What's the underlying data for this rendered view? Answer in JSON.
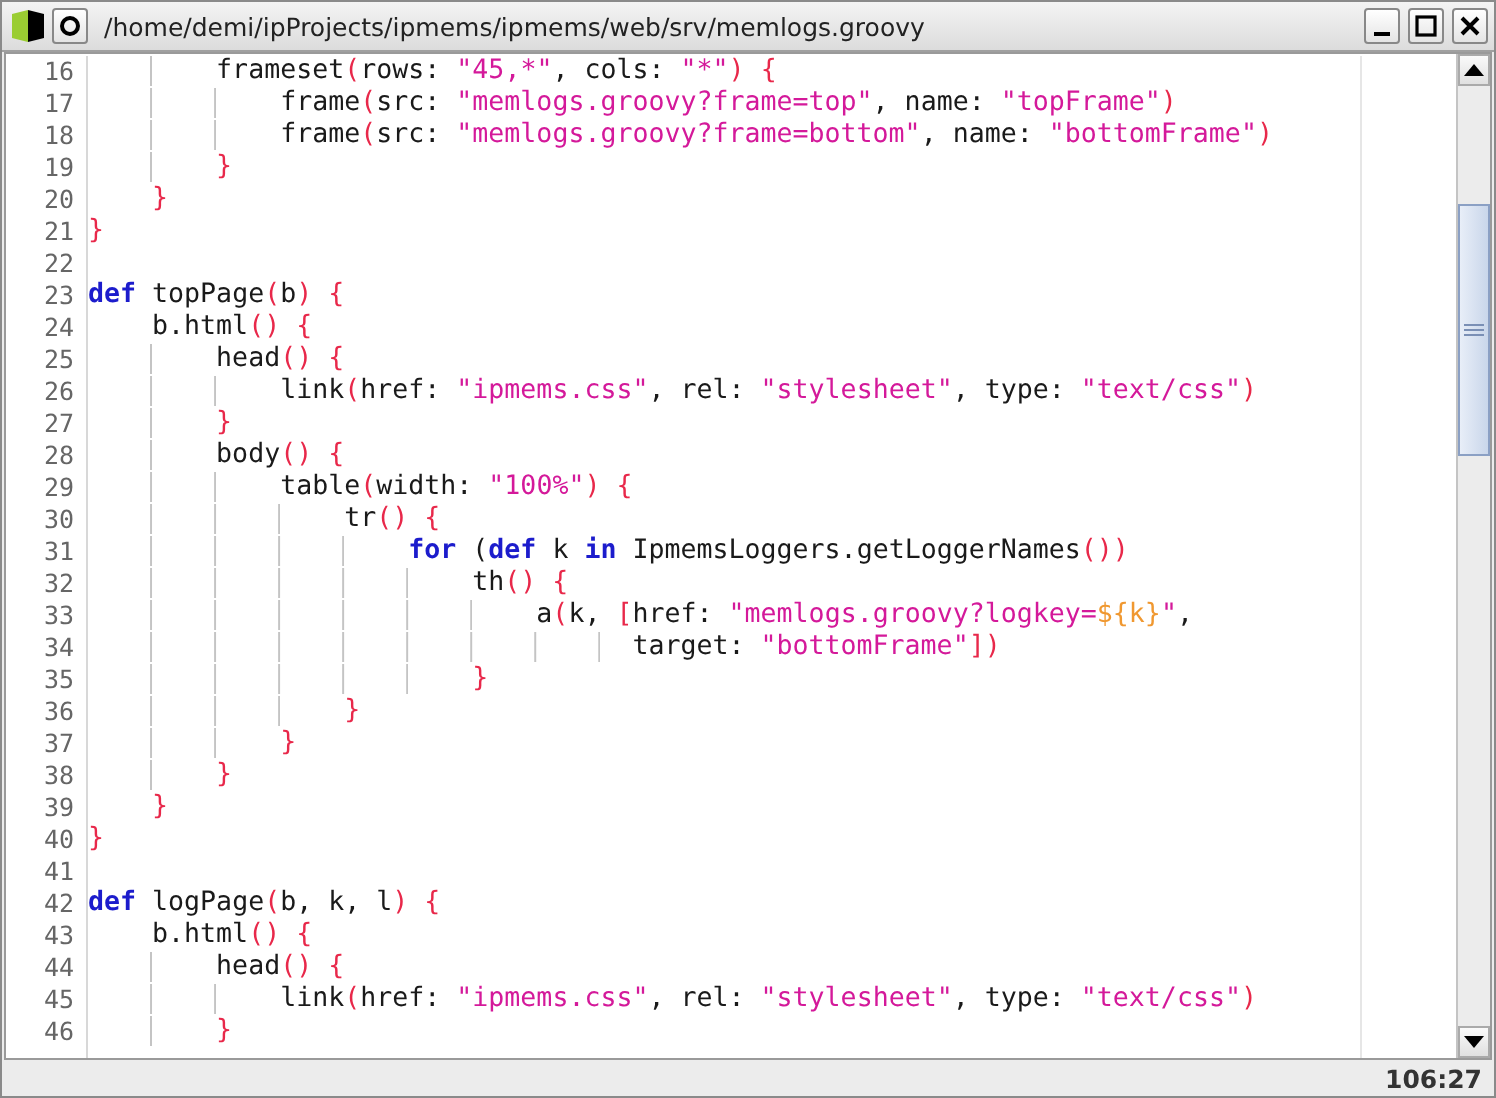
{
  "window": {
    "title": "/home/demi/ipProjects/ipmems/ipmems/web/srv/memlogs.groovy"
  },
  "editor": {
    "lines": [
      {
        "number": "16",
        "tokens": [
          {
            "kind": "plain",
            "text": "        frameset"
          },
          {
            "kind": "bracket",
            "text": "("
          },
          {
            "kind": "plain",
            "text": "rows: "
          },
          {
            "kind": "string",
            "text": "\"45,*\""
          },
          {
            "kind": "plain",
            "text": ", cols: "
          },
          {
            "kind": "string",
            "text": "\"*\""
          },
          {
            "kind": "bracket",
            "text": ")"
          },
          {
            "kind": "bracket",
            "text": " {"
          }
        ]
      },
      {
        "number": "17",
        "tokens": [
          {
            "kind": "plain",
            "text": "            frame"
          },
          {
            "kind": "bracket",
            "text": "("
          },
          {
            "kind": "plain",
            "text": "src: "
          },
          {
            "kind": "string",
            "text": "\"memlogs.groovy?frame=top\""
          },
          {
            "kind": "plain",
            "text": ", name: "
          },
          {
            "kind": "string",
            "text": "\"topFrame\""
          },
          {
            "kind": "bracket",
            "text": ")"
          }
        ]
      },
      {
        "number": "18",
        "tokens": [
          {
            "kind": "plain",
            "text": "            frame"
          },
          {
            "kind": "bracket",
            "text": "("
          },
          {
            "kind": "plain",
            "text": "src: "
          },
          {
            "kind": "string",
            "text": "\"memlogs.groovy?frame=bottom\""
          },
          {
            "kind": "plain",
            "text": ", name: "
          },
          {
            "kind": "string",
            "text": "\"bottomFrame\""
          },
          {
            "kind": "bracket",
            "text": ")"
          }
        ]
      },
      {
        "number": "19",
        "tokens": [
          {
            "kind": "bracket",
            "text": "        }"
          }
        ]
      },
      {
        "number": "20",
        "tokens": [
          {
            "kind": "bracket",
            "text": "    }"
          }
        ]
      },
      {
        "number": "21",
        "tokens": [
          {
            "kind": "bracket",
            "text": "}"
          }
        ]
      },
      {
        "number": "22"
      },
      {
        "number": "23",
        "tokens": [
          {
            "kind": "keyword",
            "text": "def"
          },
          {
            "kind": "plain",
            "text": " topPage"
          },
          {
            "kind": "bracket",
            "text": "("
          },
          {
            "kind": "plain",
            "text": "b"
          },
          {
            "kind": "bracket",
            "text": ") {"
          }
        ]
      },
      {
        "number": "24",
        "tokens": [
          {
            "kind": "plain",
            "text": "    b.html"
          },
          {
            "kind": "bracket",
            "text": "() {"
          }
        ]
      },
      {
        "number": "25",
        "tokens": [
          {
            "kind": "plain",
            "text": "        head"
          },
          {
            "kind": "bracket",
            "text": "() {"
          }
        ]
      },
      {
        "number": "26",
        "tokens": [
          {
            "kind": "plain",
            "text": "            link"
          },
          {
            "kind": "bracket",
            "text": "("
          },
          {
            "kind": "plain",
            "text": "href: "
          },
          {
            "kind": "string",
            "text": "\"ipmems.css\""
          },
          {
            "kind": "plain",
            "text": ", rel: "
          },
          {
            "kind": "string",
            "text": "\"stylesheet\""
          },
          {
            "kind": "plain",
            "text": ", type: "
          },
          {
            "kind": "string",
            "text": "\"text/css\""
          },
          {
            "kind": "bracket",
            "text": ")"
          }
        ]
      },
      {
        "number": "27",
        "tokens": [
          {
            "kind": "bracket",
            "text": "        }"
          }
        ]
      },
      {
        "number": "28",
        "tokens": [
          {
            "kind": "plain",
            "text": "        body"
          },
          {
            "kind": "bracket",
            "text": "() {"
          }
        ]
      },
      {
        "number": "29",
        "tokens": [
          {
            "kind": "plain",
            "text": "            table"
          },
          {
            "kind": "bracket",
            "text": "("
          },
          {
            "kind": "plain",
            "text": "width: "
          },
          {
            "kind": "string",
            "text": "\"100%\""
          },
          {
            "kind": "bracket",
            "text": ") {"
          }
        ]
      },
      {
        "number": "30",
        "tokens": [
          {
            "kind": "plain",
            "text": "                tr"
          },
          {
            "kind": "bracket",
            "text": "() {"
          }
        ]
      },
      {
        "number": "31",
        "tokens": [
          {
            "kind": "keyword",
            "text": "                    for"
          },
          {
            "kind": "plain",
            "text": " ("
          },
          {
            "kind": "keyword",
            "text": "def"
          },
          {
            "kind": "plain",
            "text": " k "
          },
          {
            "kind": "keyword",
            "text": "in"
          },
          {
            "kind": "plain",
            "text": " IpmemsLoggers.getLoggerNames"
          },
          {
            "kind": "bracket",
            "text": "())"
          }
        ]
      },
      {
        "number": "32",
        "tokens": [
          {
            "kind": "plain",
            "text": "                        th"
          },
          {
            "kind": "bracket",
            "text": "() {"
          }
        ]
      },
      {
        "number": "33",
        "tokens": [
          {
            "kind": "plain",
            "text": "                            a"
          },
          {
            "kind": "bracket",
            "text": "("
          },
          {
            "kind": "plain",
            "text": "k, "
          },
          {
            "kind": "bracket",
            "text": "["
          },
          {
            "kind": "plain",
            "text": "href: "
          },
          {
            "kind": "string",
            "text": "\"memlogs.groovy?logkey="
          },
          {
            "kind": "interpolation",
            "text": "${k}"
          },
          {
            "kind": "string",
            "text": "\""
          },
          {
            "kind": "plain",
            "text": ","
          }
        ]
      },
      {
        "number": "34",
        "tokens": [
          {
            "kind": "plain",
            "text": "                                  target: "
          },
          {
            "kind": "string",
            "text": "\"bottomFrame\""
          },
          {
            "kind": "bracket",
            "text": "])"
          }
        ]
      },
      {
        "number": "35",
        "tokens": [
          {
            "kind": "bracket",
            "text": "                        }"
          }
        ]
      },
      {
        "number": "36",
        "tokens": [
          {
            "kind": "bracket",
            "text": "                }"
          }
        ]
      },
      {
        "number": "37",
        "tokens": [
          {
            "kind": "bracket",
            "text": "            }"
          }
        ]
      },
      {
        "number": "38",
        "tokens": [
          {
            "kind": "bracket",
            "text": "        }"
          }
        ]
      },
      {
        "number": "39",
        "tokens": [
          {
            "kind": "bracket",
            "text": "    }"
          }
        ]
      },
      {
        "number": "40",
        "tokens": [
          {
            "kind": "bracket",
            "text": "}"
          }
        ]
      },
      {
        "number": "41"
      },
      {
        "number": "42",
        "tokens": [
          {
            "kind": "keyword",
            "text": "def"
          },
          {
            "kind": "plain",
            "text": " logPage"
          },
          {
            "kind": "bracket",
            "text": "("
          },
          {
            "kind": "plain",
            "text": "b, k, l"
          },
          {
            "kind": "bracket",
            "text": ") {"
          }
        ]
      },
      {
        "number": "43",
        "tokens": [
          {
            "kind": "plain",
            "text": "    b.html"
          },
          {
            "kind": "bracket",
            "text": "() {"
          }
        ]
      },
      {
        "number": "44",
        "tokens": [
          {
            "kind": "plain",
            "text": "        head"
          },
          {
            "kind": "bracket",
            "text": "() {"
          }
        ]
      },
      {
        "number": "45",
        "tokens": [
          {
            "kind": "plain",
            "text": "            link"
          },
          {
            "kind": "bracket",
            "text": "("
          },
          {
            "kind": "plain",
            "text": "href: "
          },
          {
            "kind": "string",
            "text": "\"ipmems.css\""
          },
          {
            "kind": "plain",
            "text": ", rel: "
          },
          {
            "kind": "string",
            "text": "\"stylesheet\""
          },
          {
            "kind": "plain",
            "text": ", type: "
          },
          {
            "kind": "string",
            "text": "\"text/css\""
          },
          {
            "kind": "bracket",
            "text": ")"
          }
        ]
      },
      {
        "number": "46",
        "tokens": [
          {
            "kind": "bracket",
            "text": "        }"
          }
        ]
      }
    ]
  },
  "status_bar": {
    "position": "106:27"
  }
}
